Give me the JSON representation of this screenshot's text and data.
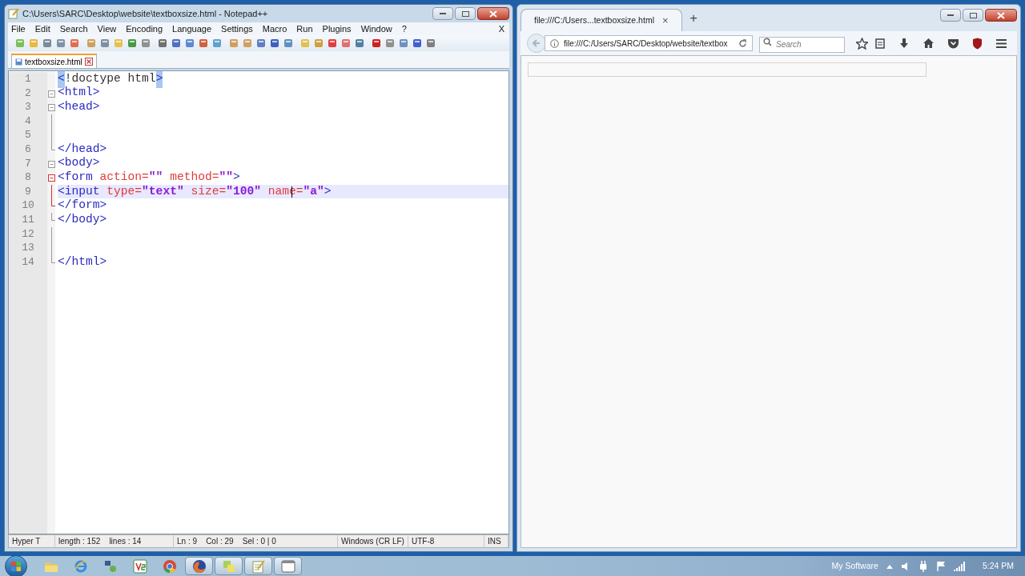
{
  "editor_window": {
    "title": "C:\\Users\\SARC\\Desktop\\website\\textboxsize.html - Notepad++",
    "menu": [
      "File",
      "Edit",
      "Search",
      "View",
      "Encoding",
      "Language",
      "Settings",
      "Macro",
      "Run",
      "Plugins",
      "Window",
      "?"
    ],
    "menu_close": "X",
    "tabs": [
      {
        "label": "textboxsize.html",
        "selected": true
      }
    ],
    "lines": [
      {
        "number": "1",
        "current": false,
        "tokens": [
          {
            "t": "<",
            "kind": "tag",
            "match": true
          },
          {
            "t": "!doctype html",
            "kind": "plain",
            "match": false
          },
          {
            "t": ">",
            "kind": "tag",
            "match": true
          }
        ]
      },
      {
        "number": "2",
        "current": false,
        "fold": {
          "kind": "open",
          "active": false
        },
        "tokens": [
          {
            "t": "<html>",
            "kind": "tag",
            "match": false
          }
        ]
      },
      {
        "number": "3",
        "current": false,
        "fold": {
          "kind": "open",
          "active": false
        },
        "tokens": [
          {
            "t": "<head>",
            "kind": "tag",
            "match": false
          }
        ]
      },
      {
        "number": "4",
        "current": false,
        "fold": {
          "kind": "line",
          "active": false
        }
      },
      {
        "number": "5",
        "current": false,
        "fold": {
          "kind": "line",
          "active": false
        }
      },
      {
        "number": "6",
        "current": false,
        "fold": {
          "kind": "end",
          "active": false
        },
        "tokens": [
          {
            "t": "</head>",
            "kind": "tag",
            "match": false
          }
        ]
      },
      {
        "number": "7",
        "current": false,
        "fold": {
          "kind": "open",
          "active": false
        },
        "tokens": [
          {
            "t": "<body>",
            "kind": "tag",
            "match": false
          }
        ]
      },
      {
        "number": "8",
        "current": false,
        "fold": {
          "kind": "open",
          "active": true
        },
        "tokens": [
          {
            "t": "<form ",
            "kind": "tag",
            "match": false
          },
          {
            "t": "action=",
            "kind": "attr",
            "match": false
          },
          {
            "t": "\"\" ",
            "kind": "value",
            "match": false
          },
          {
            "t": "method=",
            "kind": "attr",
            "match": false
          },
          {
            "t": "\"\"",
            "kind": "value",
            "match": false
          },
          {
            "t": ">",
            "kind": "tag",
            "match": false
          }
        ]
      },
      {
        "number": "9",
        "current": true,
        "fold": {
          "kind": "line",
          "active": true
        },
        "tokens": [
          {
            "t": "<input ",
            "kind": "tag",
            "match": false
          },
          {
            "t": "type=",
            "kind": "attr",
            "match": false
          },
          {
            "t": "\"text\" ",
            "kind": "value",
            "match": false
          },
          {
            "t": "size=",
            "kind": "attr",
            "match": false
          },
          {
            "t": "\"100\" ",
            "kind": "value",
            "match": false
          },
          {
            "t": "name=",
            "kind": "attr",
            "match": false
          },
          {
            "t": "\"a\"",
            "kind": "value",
            "match": false
          },
          {
            "t": ">",
            "kind": "tag",
            "match": false
          }
        ]
      },
      {
        "number": "10",
        "current": false,
        "fold": {
          "kind": "end",
          "active": true
        },
        "tokens": [
          {
            "t": "</form>",
            "kind": "tag",
            "match": false
          }
        ]
      },
      {
        "number": "11",
        "current": false,
        "fold": {
          "kind": "end",
          "active": false
        },
        "tokens": [
          {
            "t": "</body>",
            "kind": "tag",
            "match": false
          }
        ]
      },
      {
        "number": "12",
        "current": false,
        "fold": {
          "kind": "line",
          "active": false
        }
      },
      {
        "number": "13",
        "current": false,
        "fold": {
          "kind": "line",
          "active": false
        }
      },
      {
        "number": "14",
        "current": false,
        "fold": {
          "kind": "end",
          "active": false
        },
        "tokens": [
          {
            "t": "</html>",
            "kind": "tag",
            "match": false
          }
        ]
      }
    ],
    "status_bar": [
      "Hyper T",
      "length : 152    lines : 14",
      "Ln : 9    Col : 29    Sel : 0 | 0",
      "Windows (CR LF)",
      "UTF-8",
      "INS"
    ]
  },
  "browser_window": {
    "tabs": [
      {
        "label": "file:///C:/Users...textboxsize.html",
        "selected": true
      }
    ],
    "tab_close": "×",
    "new_tab": "+",
    "address": "file:///C:/Users/SARC/Desktop/website/textbox",
    "search": {
      "placeholder": "Search"
    }
  },
  "taskbar": {
    "items": [
      {
        "kind": "folder",
        "open": false
      },
      {
        "kind": "ie",
        "open": false
      },
      {
        "kind": "network",
        "open": false
      },
      {
        "kind": "v2",
        "open": false
      },
      {
        "kind": "chrome",
        "open": false
      },
      {
        "kind": "firefox",
        "open": true
      },
      {
        "kind": "files",
        "open": true
      },
      {
        "kind": "notepad",
        "open": true
      },
      {
        "kind": "window",
        "open": true
      }
    ],
    "tray_label": "My Software",
    "clock": "5:24 PM"
  }
}
